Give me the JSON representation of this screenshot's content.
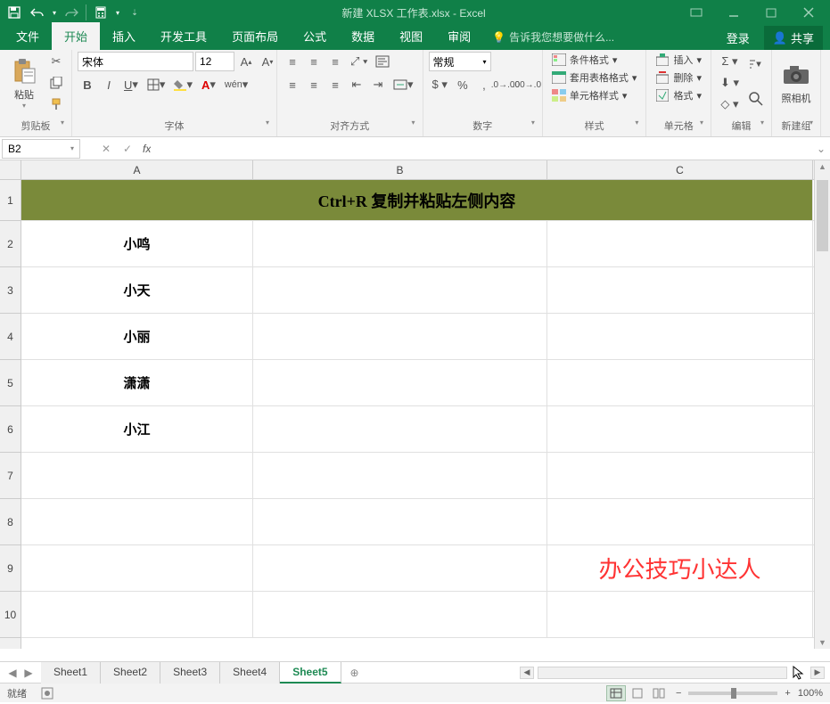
{
  "title": "新建 XLSX 工作表.xlsx - Excel",
  "tabs": {
    "file": "文件",
    "home": "开始",
    "insert": "插入",
    "dev": "开发工具",
    "layout": "页面布局",
    "formulas": "公式",
    "data": "数据",
    "view": "视图",
    "review": "审阅",
    "tell_me": "告诉我您想要做什么...",
    "login": "登录",
    "share": "共享"
  },
  "ribbon": {
    "clipboard": {
      "paste": "粘贴",
      "label": "剪贴板"
    },
    "font": {
      "name": "宋体",
      "size": "12",
      "label": "字体"
    },
    "align": {
      "label": "对齐方式"
    },
    "number": {
      "format": "常规",
      "label": "数字"
    },
    "styles": {
      "cond": "条件格式",
      "table": "套用表格格式",
      "cell": "单元格样式",
      "label": "样式"
    },
    "cells": {
      "insert": "插入",
      "delete": "删除",
      "format": "格式",
      "label": "单元格"
    },
    "editing": {
      "label": "编辑"
    },
    "newgroup": {
      "camera": "照相机",
      "label": "新建组"
    }
  },
  "namebox": "B2",
  "columns": [
    "A",
    "B",
    "C"
  ],
  "row1_merged": "Ctrl+R   复制并粘贴左侧内容",
  "data_rows": [
    {
      "a": "小鸣",
      "b": "",
      "c": ""
    },
    {
      "a": "小天",
      "b": "",
      "c": ""
    },
    {
      "a": "小丽",
      "b": "",
      "c": ""
    },
    {
      "a": "潇潇",
      "b": "",
      "c": ""
    },
    {
      "a": "小江",
      "b": "",
      "c": ""
    }
  ],
  "watermark": "办公技巧小达人",
  "sheets": [
    "Sheet1",
    "Sheet2",
    "Sheet3",
    "Sheet4",
    "Sheet5"
  ],
  "active_sheet": 4,
  "status": {
    "ready": "就绪",
    "zoom": "100%"
  }
}
